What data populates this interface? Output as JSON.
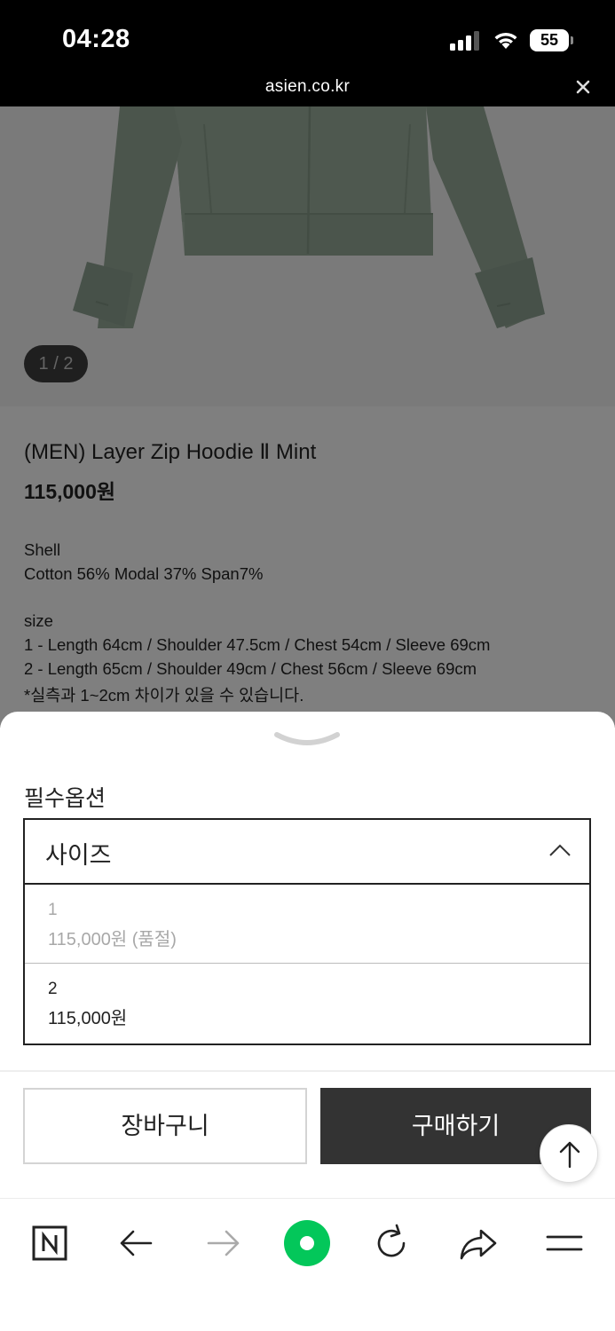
{
  "status_bar": {
    "time": "04:28",
    "battery": "55"
  },
  "browser": {
    "url": "asien.co.kr"
  },
  "gallery": {
    "counter": "1 / 2"
  },
  "product": {
    "name": "(MEN) Layer Zip Hoodie  Ⅱ  Mint",
    "price": "115,000원",
    "material_heading": "Shell",
    "material": "Cotton 56% Modal 37% Span7%",
    "size_heading": "size",
    "size_1": "1 - Length 64cm / Shoulder 47.5cm / Chest 54cm / Sleeve 69cm",
    "size_2": "2 - Length 65cm / Shoulder 49cm / Chest 56cm / Sleeve 69cm",
    "size_note": "*실측과 1~2cm 차이가 있을 수 있습니다."
  },
  "options_sheet": {
    "label": "필수옵션",
    "select_value": "사이즈",
    "options": [
      {
        "name": "1",
        "price": "115,000원 (품절)",
        "sold_out": true
      },
      {
        "name": "2",
        "price": "115,000원",
        "sold_out": false
      }
    ],
    "cart_button": "장바구니",
    "buy_button": "구매하기"
  },
  "icons": {
    "scroll_top": "arrow-up-icon",
    "toolbar": [
      "naver-home-icon",
      "back-arrow-icon",
      "forward-arrow-icon",
      "green-dot-icon",
      "reload-icon",
      "share-icon",
      "menu-icon"
    ]
  },
  "colors": {
    "buy_button": "#333333",
    "green_dot": "#03c75a",
    "hoodie": "#8fa493"
  }
}
